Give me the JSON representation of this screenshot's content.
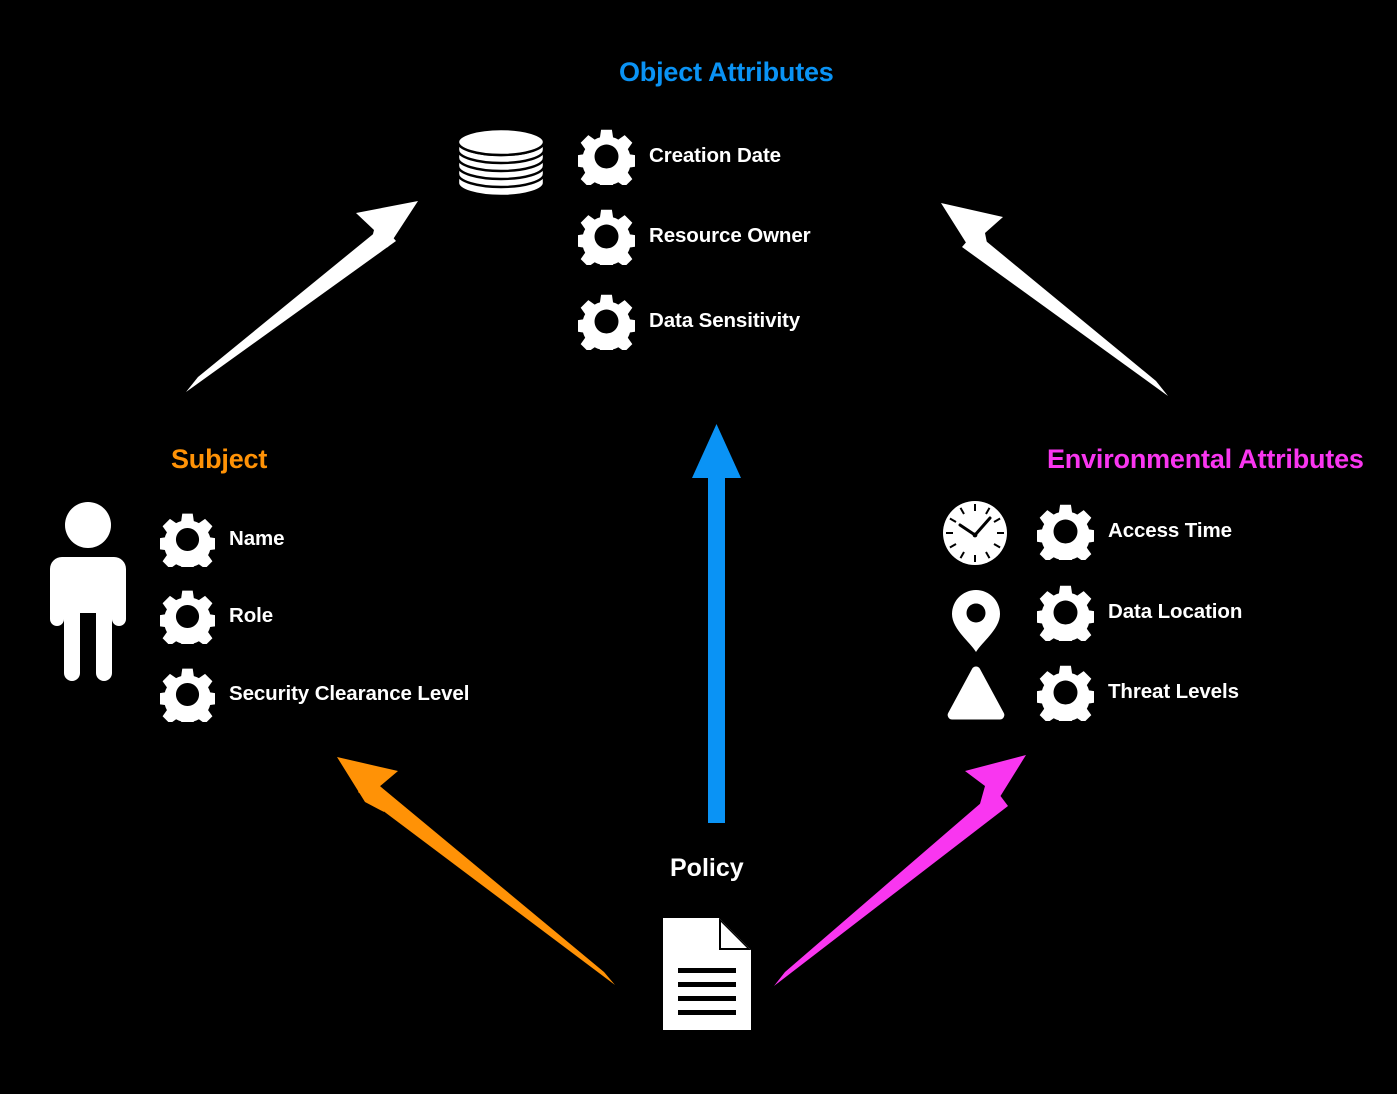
{
  "diagram": {
    "title_object": "Object Attributes",
    "title_subject": "Subject",
    "title_environment": "Environmental Attributes",
    "policy_label": "Policy",
    "background_color": "#000000",
    "colors": {
      "object_blue": "#0A93F5",
      "subject_orange": "#FF9206",
      "environment_magenta": "#F936F0",
      "arrow_white": "#FFFFFF",
      "icon_white": "#FFFFFF",
      "text_white": "#FFFFFF"
    }
  },
  "object_group": {
    "heading": "Object Attributes",
    "main_icon": "database-stack-icon",
    "attributes": [
      {
        "label": "Creation Date",
        "icon": "gear-icon"
      },
      {
        "label": "Resource Owner",
        "icon": "gear-icon"
      },
      {
        "label": "Data Sensitivity",
        "icon": "gear-icon"
      }
    ]
  },
  "subject_group": {
    "heading": "Subject",
    "main_icon": "person-icon",
    "attributes": [
      {
        "label": "Name",
        "icon": "gear-icon"
      },
      {
        "label": "Role",
        "icon": "gear-icon"
      },
      {
        "label": "Security Clearance Level",
        "icon": "gear-icon"
      }
    ]
  },
  "environment_group": {
    "heading": "Environmental Attributes",
    "attributes": [
      {
        "label": "Access Time",
        "icon": "gear-icon",
        "side_icon": "clock-icon"
      },
      {
        "label": "Data Location",
        "icon": "gear-icon",
        "side_icon": "location-pin-icon"
      },
      {
        "label": "Threat Levels",
        "icon": "gear-icon",
        "side_icon": "warning-triangle-icon"
      }
    ]
  },
  "policy": {
    "label": "Policy",
    "icon": "document-icon"
  },
  "arrows": [
    {
      "name": "subject-to-object-arrow",
      "color": "#FFFFFF",
      "from": "subject",
      "to": "object"
    },
    {
      "name": "environment-to-object-arrow",
      "color": "#FFFFFF",
      "from": "environment",
      "to": "object"
    },
    {
      "name": "policy-to-object-arrow",
      "color": "#0A93F5",
      "from": "policy",
      "to": "object"
    },
    {
      "name": "policy-to-subject-arrow",
      "color": "#FF9206",
      "from": "policy",
      "to": "subject"
    },
    {
      "name": "policy-to-environment-arrow",
      "color": "#F936F0",
      "from": "policy",
      "to": "environment"
    }
  ]
}
